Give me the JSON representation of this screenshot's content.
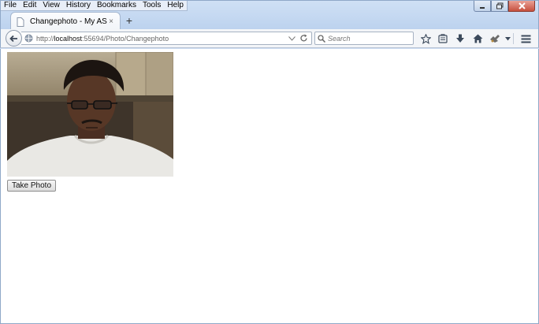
{
  "menu": {
    "items": [
      {
        "label": "File"
      },
      {
        "label": "Edit"
      },
      {
        "label": "View"
      },
      {
        "label": "History"
      },
      {
        "label": "Bookmarks"
      },
      {
        "label": "Tools"
      },
      {
        "label": "Help"
      }
    ]
  },
  "tab": {
    "title": "Changephoto - My ASP.NE...",
    "close": "×"
  },
  "new_tab": "+",
  "urlbar": {
    "scheme": "http://",
    "host": "localhost",
    "path": ":55694/Photo/Changephoto"
  },
  "search": {
    "placeholder": "Search"
  },
  "page": {
    "take_photo_label": "Take Photo"
  },
  "colors": {
    "accent": "#3c5a8c",
    "close_button": "#c7503e"
  }
}
